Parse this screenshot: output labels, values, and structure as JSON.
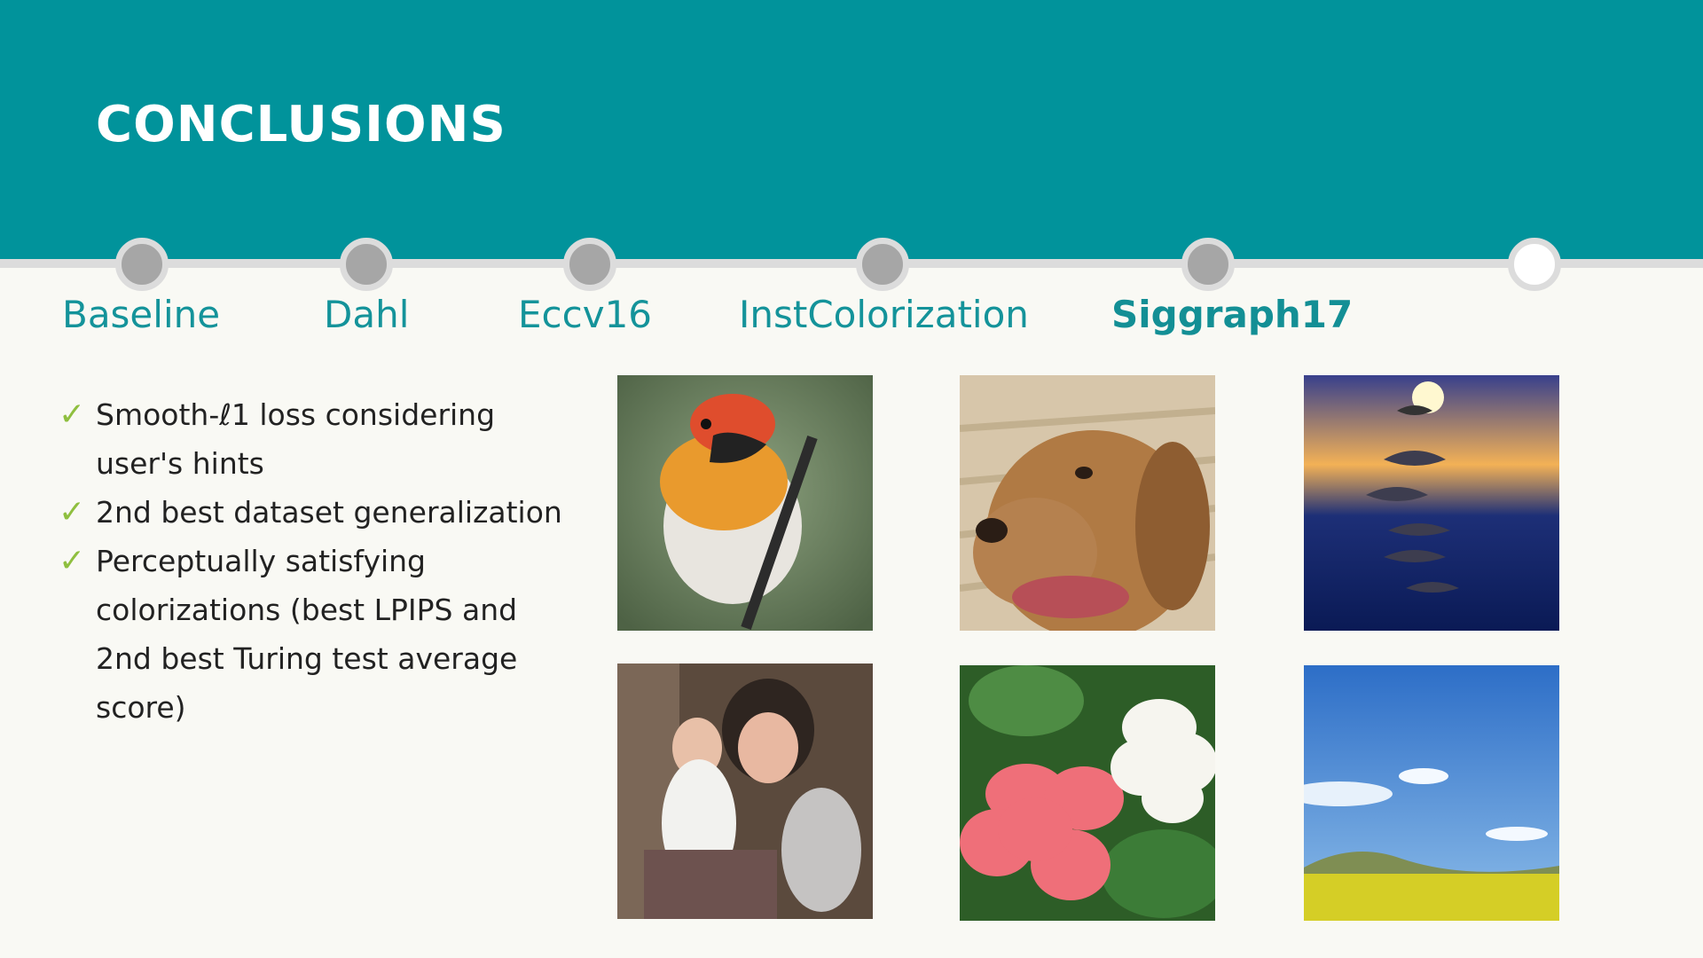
{
  "header": {
    "title": "CONCLUSIONS"
  },
  "timeline": {
    "tabs": [
      {
        "label": "Baseline"
      },
      {
        "label": "Dahl"
      },
      {
        "label": "Eccv16"
      },
      {
        "label": "InstColorization"
      },
      {
        "label": "Siggraph17",
        "active": true
      }
    ]
  },
  "bullets": [
    "Smooth-ℓ1 loss considering user's hints",
    "2nd best dataset generalization",
    "Perceptually satisfying colorizations (best LPIPS and 2nd best Turing test average score)"
  ],
  "colors": {
    "header": "#01939b",
    "accent": "#14939a",
    "check": "#8fbf3f",
    "background": "#f9f9f4"
  },
  "icons": {
    "check": "check-icon"
  }
}
